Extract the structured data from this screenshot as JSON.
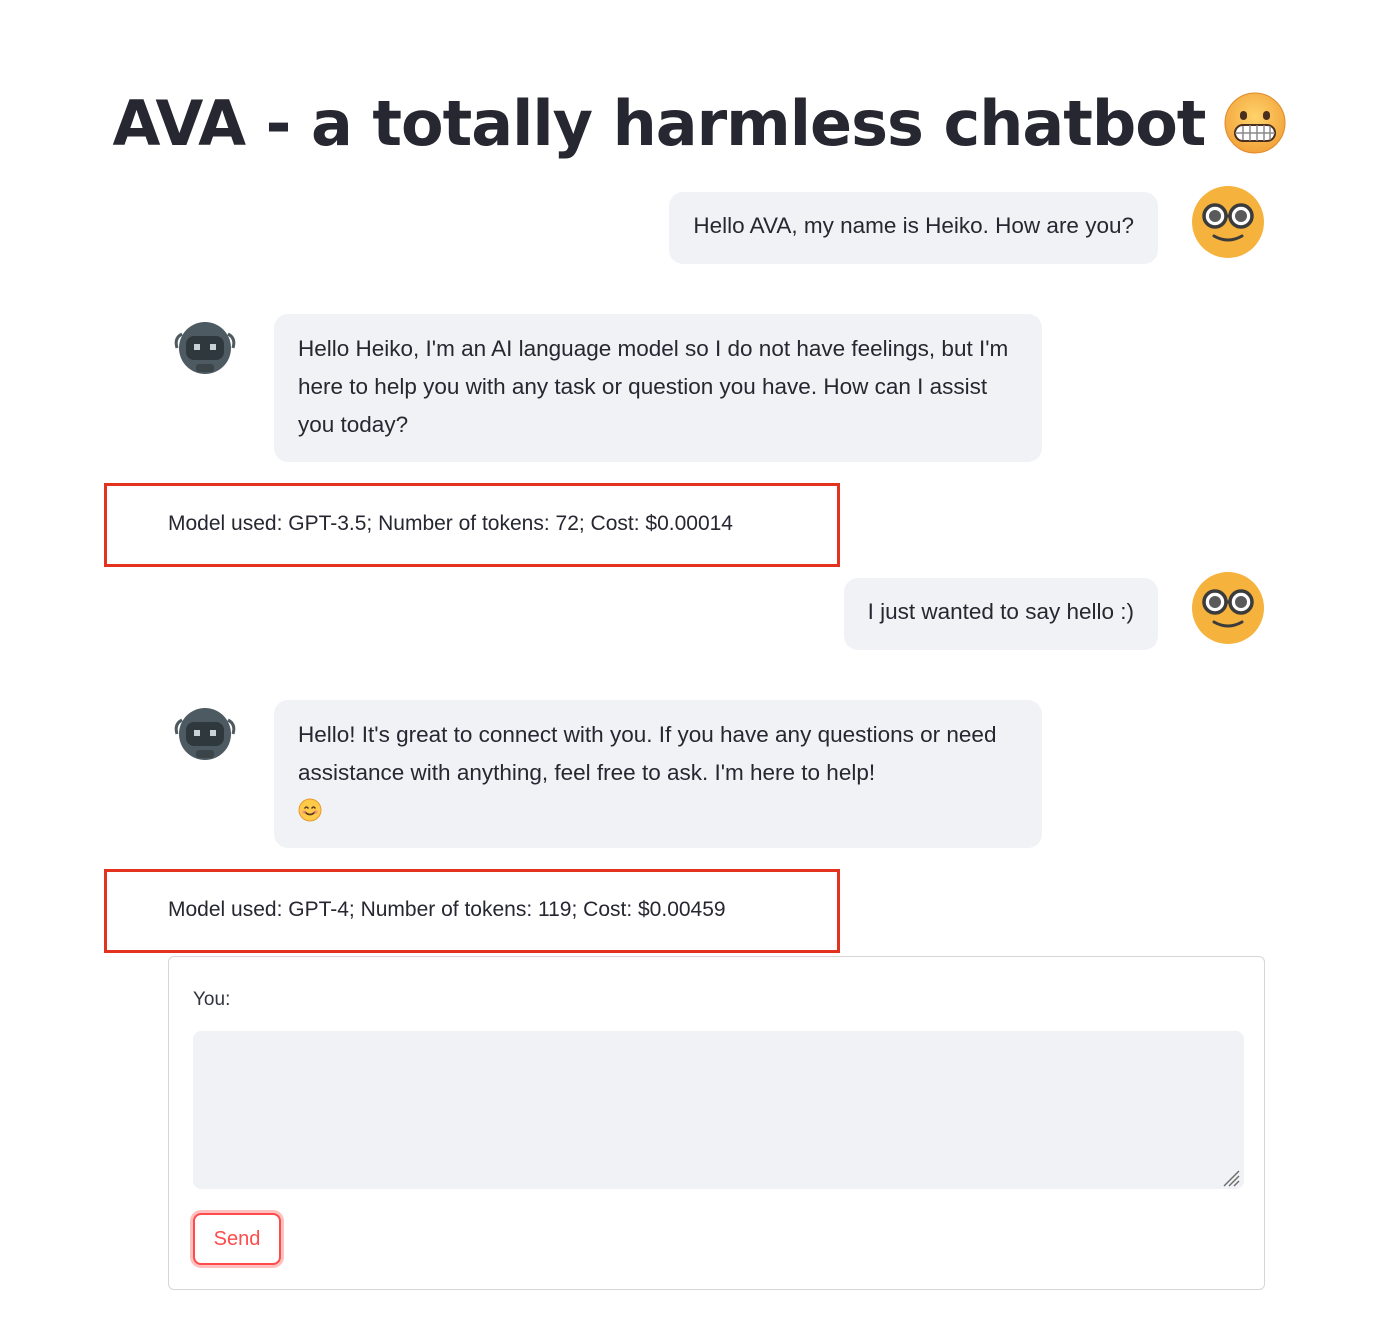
{
  "page": {
    "title": "AVA - a totally harmless chatbot",
    "title_emoji": "grimacing-face-emoji"
  },
  "messages": [
    {
      "role": "user",
      "avatar": "nerd-face-avatar",
      "text": "Hello AVA, my name is Heiko. How are you?"
    },
    {
      "role": "assistant",
      "avatar": "robot-avatar",
      "text": "Hello Heiko, I'm an AI language model so I do not have feelings, but I'm here to help you with any task or question you have. How can I assist you today?"
    },
    {
      "role": "info",
      "text": "Model used: GPT-3.5; Number of tokens: 72; Cost: $0.00014"
    },
    {
      "role": "user",
      "avatar": "nerd-face-avatar",
      "text": "I just wanted to say hello :)"
    },
    {
      "role": "assistant",
      "avatar": "robot-avatar",
      "text": "Hello! It's great to connect with you. If you have any questions or need assistance with anything, feel free to ask. I'm here to help!",
      "trailing_emoji": "smiling-face-emoji"
    },
    {
      "role": "info",
      "text": "Model used: GPT-4; Number of tokens: 119; Cost: $0.00459"
    }
  ],
  "form": {
    "label": "You:",
    "input_value": "",
    "send_label": "Send"
  },
  "colors": {
    "accent": "#ff4b4b",
    "highlight_box": "#e3321e",
    "bubble_bg": "#f0f2f6",
    "text": "#262730"
  }
}
